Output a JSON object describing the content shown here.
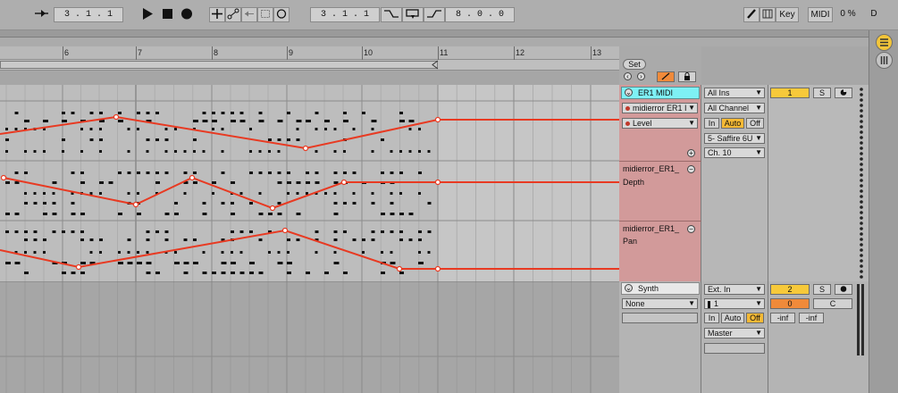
{
  "transport": {
    "follow_icon": "follow-arrow-icon",
    "position": "3 .   1 .   1",
    "play_icon": "play-icon",
    "stop_icon": "stop-icon",
    "record_icon": "record-icon",
    "overdub_icon": "plus-icon",
    "automation_arm_icon": "automation-arm-icon",
    "punch_icon": "punch-icon",
    "loop_icon": "loop-icon",
    "metronome_icon": "metronome-icon",
    "loop_start": "3 .   1 .   1",
    "punch_in_icon": "punch-in-icon",
    "loop_switch_icon": "loop-switch-icon",
    "punch_out_icon": "punch-out-icon",
    "loop_length": "8 .   0 .   0",
    "draw_icon": "pencil-icon",
    "key_label": "Key",
    "midi_label": "MIDI",
    "cpu": "0 %",
    "disk": "D"
  },
  "ruler": {
    "bars": [
      "6",
      "7",
      "8",
      "9",
      "10",
      "11",
      "12",
      "13"
    ]
  },
  "set_panel": {
    "set_label": "Set",
    "back_icon": "arrow-left-icon",
    "forward_icon": "arrow-right-icon",
    "locators_icon": "locator-icon",
    "lock_icon": "lock-icon"
  },
  "tracks": [
    {
      "name": "ER1 MIDI",
      "device": "midierror ER1 I",
      "parameter": "Level",
      "input_type": "All Ins",
      "input_channel": "All Channel",
      "monitor": [
        "In",
        "Auto",
        "Off"
      ],
      "output_type": "5- Saffire 6U",
      "output_channel": "Ch. 10",
      "number": "1",
      "solo": "S",
      "arm_icon": "arm-record-icon",
      "lanes": [
        {
          "device": "midierror_ER1_",
          "parameter": "Depth"
        },
        {
          "device": "midierror_ER1_",
          "parameter": "Pan"
        }
      ]
    },
    {
      "name": "Synth",
      "device": "None",
      "input_type": "Ext. In",
      "input_channel": "1",
      "monitor": [
        "In",
        "Auto",
        "Off"
      ],
      "output_type": "Master",
      "number": "2",
      "solo": "S",
      "volume": "0",
      "pan": "C",
      "sends": [
        "-inf",
        "-inf"
      ]
    }
  ],
  "colors": {
    "track1_header": "#7ef1f5",
    "automation_lane": "#d29a9a",
    "automation_line": "#e83a22",
    "track_number": "#f7c93a",
    "monitor_on": "#f5b935",
    "volume_orange": "#f08a3a"
  }
}
